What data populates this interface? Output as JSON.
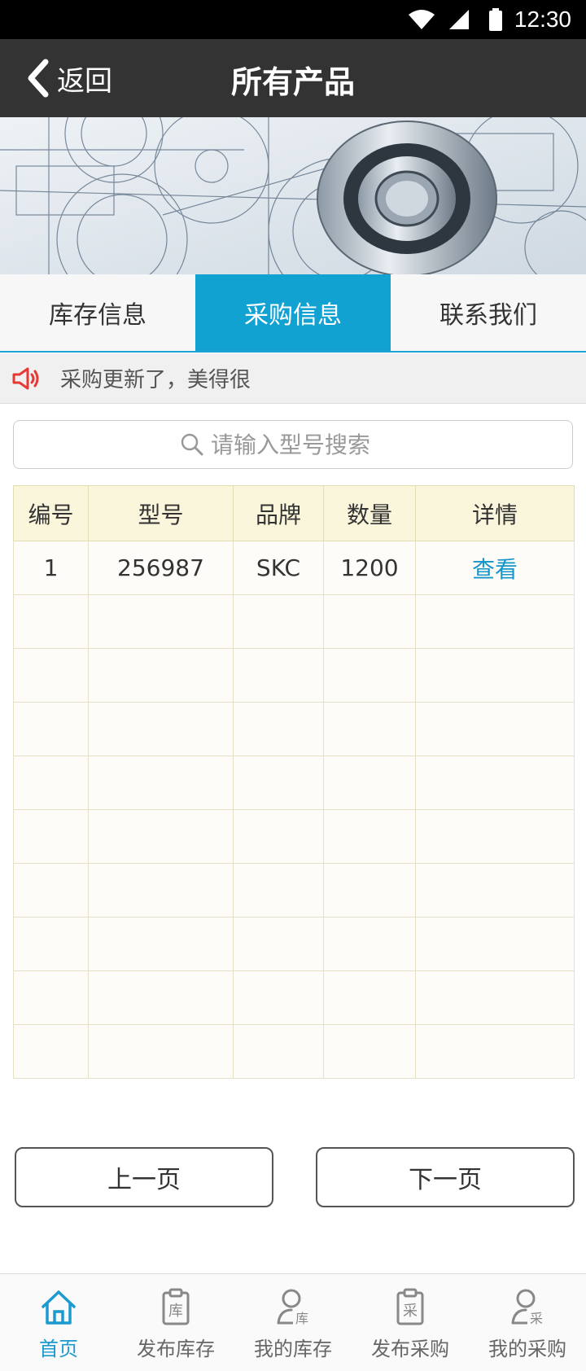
{
  "status_bar": {
    "time": "12:30"
  },
  "header": {
    "back_label": "返回",
    "title": "所有产品"
  },
  "tabs": [
    {
      "label": "库存信息",
      "active": false
    },
    {
      "label": "采购信息",
      "active": true
    },
    {
      "label": "联系我们",
      "active": false
    }
  ],
  "notice": {
    "text": "采购更新了，美得很"
  },
  "search": {
    "placeholder": "请输入型号搜索",
    "value": ""
  },
  "table": {
    "headers": [
      "编号",
      "型号",
      "品牌",
      "数量",
      "详情"
    ],
    "rows": [
      {
        "no": "1",
        "model": "256987",
        "brand": "SKC",
        "qty": "1200",
        "detail": "查看"
      }
    ]
  },
  "pager": {
    "prev": "上一页",
    "next": "下一页"
  },
  "bottom_nav": [
    {
      "label": "首页",
      "icon": "home-icon",
      "active": true
    },
    {
      "label": "发布库存",
      "icon": "clipboard-inventory-icon",
      "badge": "库"
    },
    {
      "label": "我的库存",
      "icon": "user-inventory-icon",
      "badge": "库"
    },
    {
      "label": "发布采购",
      "icon": "clipboard-purchase-icon",
      "badge": "采"
    },
    {
      "label": "我的采购",
      "icon": "user-purchase-icon",
      "badge": "采"
    }
  ],
  "colors": {
    "accent": "#12a2d2",
    "header_bg": "#333333",
    "table_header_bg": "#faf6dc",
    "link": "#1596c9",
    "notice_icon": "#e53935"
  }
}
